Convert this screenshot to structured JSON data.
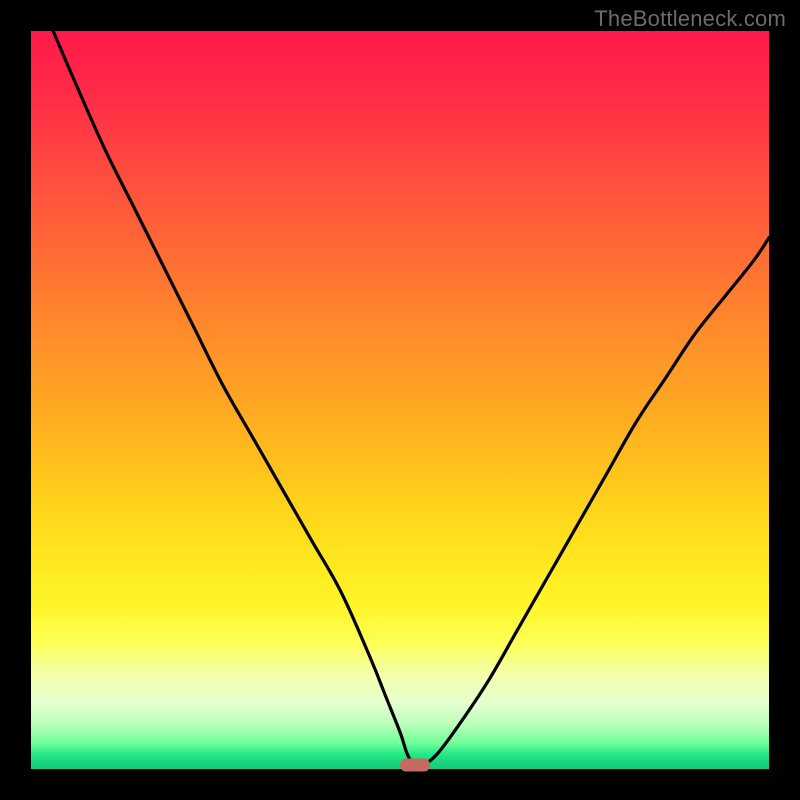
{
  "watermark": "TheBottleneck.com",
  "colors": {
    "frame_bg": "#000000",
    "curve": "#000000",
    "marker": "#c66a61",
    "watermark_text": "#6b6b6b"
  },
  "chart_data": {
    "type": "line",
    "title": "",
    "xlabel": "",
    "ylabel": "",
    "xlim": [
      0,
      100
    ],
    "ylim": [
      0,
      100
    ],
    "legend": false,
    "grid": false,
    "series": [
      {
        "name": "bottleneck-curve",
        "x": [
          3,
          6,
          10,
          14,
          18,
          22,
          26,
          30,
          34,
          38,
          42,
          46,
          48,
          50,
          51,
          52,
          53,
          55,
          58,
          62,
          66,
          70,
          74,
          78,
          82,
          86,
          90,
          94,
          98,
          100
        ],
        "y": [
          100,
          93,
          84,
          76,
          68,
          60,
          52,
          45,
          38,
          31,
          24,
          15,
          10,
          5,
          2,
          0.5,
          0.5,
          2,
          6,
          12,
          19,
          26,
          33,
          40,
          47,
          53,
          59,
          64,
          69,
          72
        ]
      }
    ],
    "marker": {
      "x": 52,
      "y": 0.5
    },
    "annotations": []
  }
}
